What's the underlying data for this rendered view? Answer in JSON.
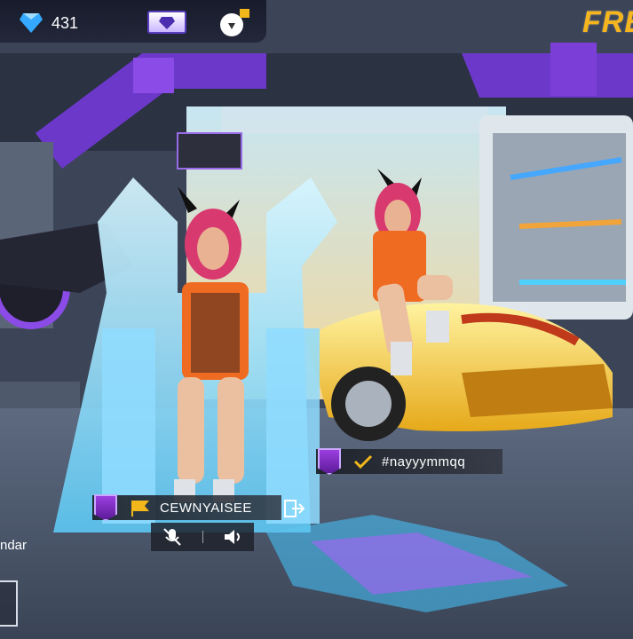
{
  "hud": {
    "diamond_icon": "diamond-icon",
    "diamond_count": "431",
    "shop_icon": "diamond-shop-icon",
    "gift_icon": "cloud-gift-icon",
    "brand_text": "FRE"
  },
  "players": [
    {
      "name": "CEWNYAISEE",
      "rank_icon": "rank-emblem-icon",
      "flag_icon": "flag-icon",
      "action_icon": "exit-icon"
    },
    {
      "name": "#nayyymmqq",
      "rank_icon": "rank-emblem-icon",
      "status_icon": "checkmark-icon"
    }
  ],
  "voice": {
    "mic_icon": "mic-muted-icon",
    "speaker_icon": "speaker-icon"
  },
  "side_label": "ndar",
  "colors": {
    "gem_blue": "#35a8ff",
    "brand_gold": "#f5b51e",
    "emblem_purple": "#8a2fd1",
    "flag_yellow": "#f2b81b",
    "car_yellow": "#f5d23a",
    "throne_ice": "#9fe4ff",
    "hair_pink": "#e3356e",
    "vest_orange": "#f06a1e"
  }
}
